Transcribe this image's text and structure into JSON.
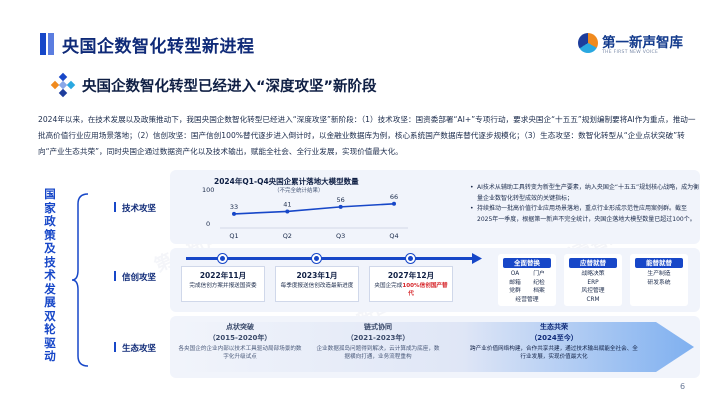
{
  "header": {
    "title": "央国企数智化转型新进程",
    "logo_text": "第一新声智库",
    "logo_sub": "THE FIRST NEW VOICE"
  },
  "subtitle": "央国企数智化转型已经进入“深度攻坚”新阶段",
  "intro": "2024年以来，在技术发展以及政策推动下，我国央国企数智化转型已经进入“深度攻坚”新阶段：（1）技术攻坚：国资委部署“AI+”专项行动，要求央国企“十五五”规划编制要将AI作为重点，推动一批高价值行业应用场景落地；（2）信创攻坚：国产信创100%替代逐步进入倒计时，以金融业数据库为例，核心系统国产数据库替代逐步规模化；（3）生态攻坚：数智化转型从“企业点状突破”转向“产业生态共荣”，同时央国企通过数据资产化以及技术输出，赋能全社会、全行业发展，实现价值最大化。",
  "left_label": [
    "国",
    "家",
    "政",
    "策",
    "及",
    "技",
    "术",
    "发",
    "展",
    "双",
    "轮",
    "驱",
    "动"
  ],
  "rows": {
    "tech": "技术攻坚",
    "xinchuang": "信创攻坚",
    "eco": "生态攻坚"
  },
  "chart_data": {
    "type": "line",
    "title": "2024年Q1-Q4央国企累计落地大模型数量",
    "subtitle": "（不完全统计结果）",
    "categories": [
      "Q1",
      "Q2",
      "Q3",
      "Q4"
    ],
    "values": [
      33,
      41,
      56,
      66
    ],
    "y_ticks": [
      "100",
      "0"
    ],
    "ylim": [
      0,
      100
    ],
    "color": "#1747c8"
  },
  "tech_bullets": [
    "AI技术从辅助工具转变为新型生产要素，纳入央国企“十五五”规划核心战略，成为衡量企业数智化转型成效的关键指标；",
    "持续推动一批高价值行业应用场景落地，重点行业形成示范性应用案例群。截至2025年一季度，根据第一新声不完全统计，央国企落地大模型数量已超过100个。"
  ],
  "timeline": [
    {
      "date": "2022年11月",
      "text": "完成信创方案并报送国资委",
      "highlight": ""
    },
    {
      "date": "2023年1月",
      "text": "每季度报送信创改造最新进度",
      "highlight": ""
    },
    {
      "date": "2027年12月",
      "text": "央国企完成",
      "highlight": "100%信创国产替代"
    }
  ],
  "categories": [
    {
      "head": "全面替换",
      "items": [
        "OA",
        "门户",
        "邮箱",
        "纪检",
        "党群",
        "档案",
        "经营管理"
      ],
      "grid": true
    },
    {
      "head": "应替就替",
      "items": [
        "战略决策",
        "ERP",
        "风控管理",
        "CRM"
      ],
      "grid": false
    },
    {
      "head": "能替就替",
      "items": [
        "生产制造",
        "研发系统"
      ],
      "grid": false
    }
  ],
  "stages": [
    {
      "name": "点状突破",
      "years": "（2015-2020年）",
      "text": "各央国企的企业内部以技术工具驱动局部场景的数字化升级试点"
    },
    {
      "name": "链式协同",
      "years": "（2021-2023年）",
      "text": "企业数据孤岛问题得到解决，云计算成为底座，数据横向打通，业务流程重构"
    },
    {
      "name": "生态共荣",
      "years": "（2024至今）",
      "text": "跨产业价值网络构建，合作共享共建，通过技术输出赋能全社会、全行业发展，实现价值最大化"
    }
  ],
  "page_number": "6"
}
